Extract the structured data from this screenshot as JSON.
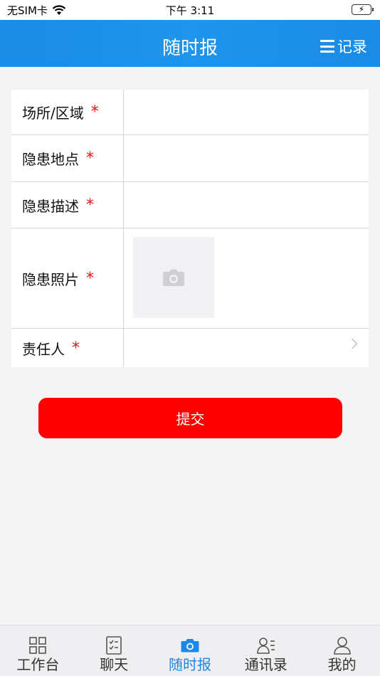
{
  "status_bar": {
    "carrier": "无SIM卡",
    "time": "下午 3:11"
  },
  "nav": {
    "title": "随时报",
    "record_label": "记录"
  },
  "form": {
    "required_mark": "*",
    "fields": [
      {
        "label": "场所/区域"
      },
      {
        "label": "隐患地点"
      },
      {
        "label": "隐患描述"
      },
      {
        "label": "隐患照片"
      },
      {
        "label": "责任人"
      }
    ]
  },
  "submit_label": "提交",
  "tabs": [
    {
      "label": "工作台",
      "icon": "grid-icon"
    },
    {
      "label": "聊天",
      "icon": "checklist-icon"
    },
    {
      "label": "随时报",
      "icon": "camera-icon",
      "active": true
    },
    {
      "label": "通讯录",
      "icon": "contacts-icon"
    },
    {
      "label": "我的",
      "icon": "person-icon"
    }
  ],
  "colors": {
    "nav_blue": "#1f95ec",
    "submit_red": "#ff0000",
    "required_red": "#ee1111",
    "active_tab": "#1e87e5"
  }
}
